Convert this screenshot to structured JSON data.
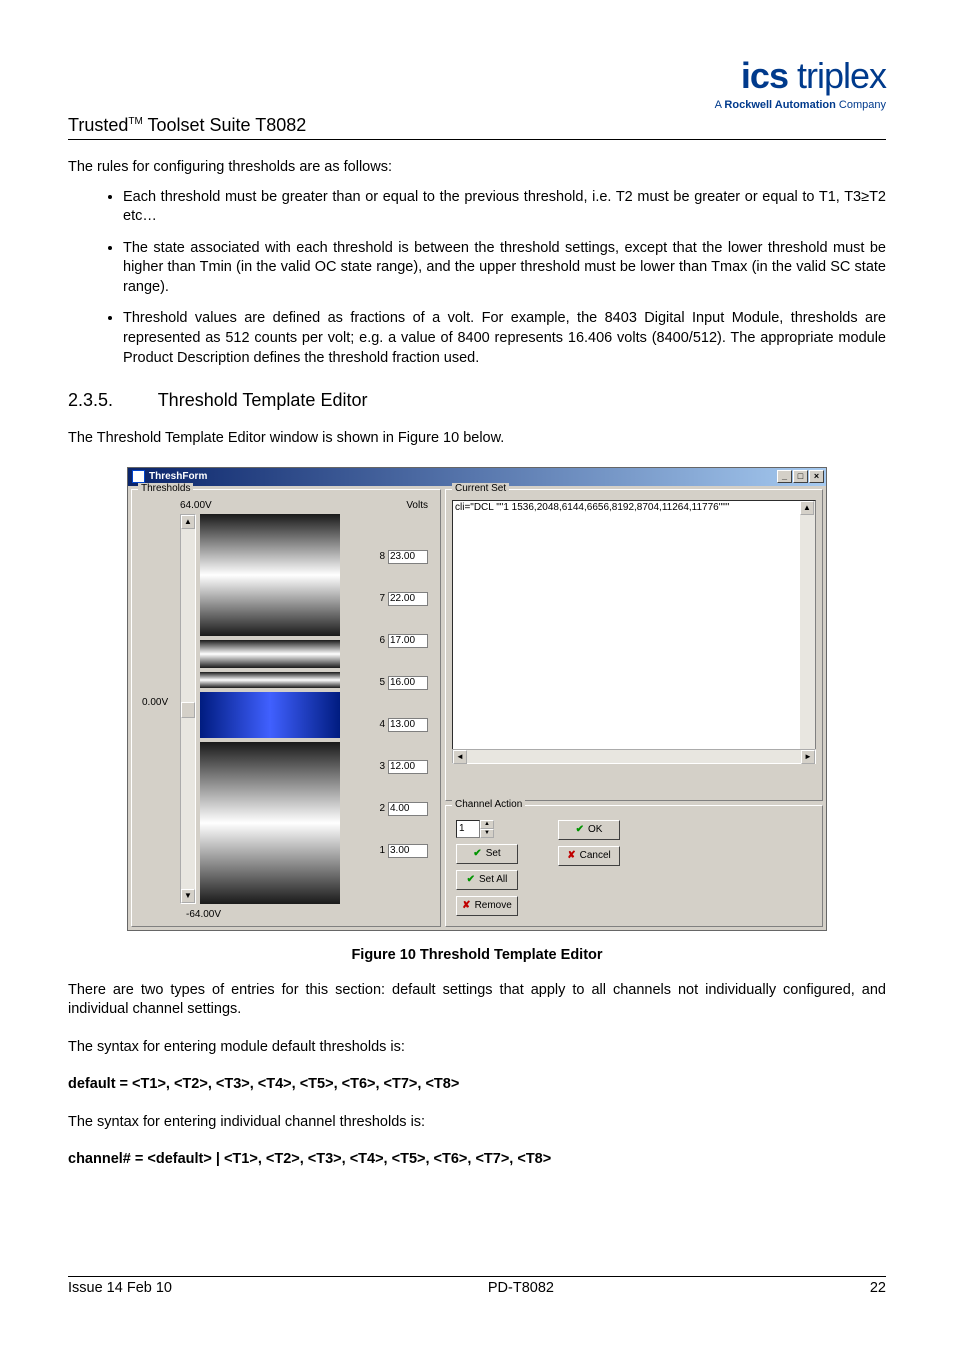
{
  "header": {
    "title_prefix": "Trusted",
    "title_tm": "TM",
    "title_suffix": " Toolset Suite T8082"
  },
  "logo": {
    "bold": "ics",
    "light": " triplex",
    "sub_a": "A ",
    "sub_b": "Rockwell Automation",
    "sub_c": " Company"
  },
  "intro": "The rules for configuring thresholds are as follows:",
  "bullets": [
    "Each threshold must be greater than or equal to the previous threshold, i.e. T2 must be greater or equal to T1, T3≥T2 etc…",
    "The state associated with each threshold is between the threshold settings, except that the lower threshold must be higher than Tmin (in the valid OC state range), and the upper threshold must be lower than Tmax (in the valid SC state range).",
    "Threshold values are defined as fractions of a volt. For example, the 8403 Digital Input Module, thresholds are represented as 512 counts per volt; e.g. a value of 8400 represents 16.406 volts (8400/512). The appropriate module Product Description defines the threshold fraction used."
  ],
  "section": {
    "num": "2.3.5.",
    "title": "Threshold Template Editor"
  },
  "section_body": "The Threshold Template Editor window is shown in Figure 10 below.",
  "window": {
    "title": "ThreshForm",
    "group_thresholds": "Thresholds",
    "group_currentset": "Current Set",
    "group_channel": "Channel Action",
    "max_v": "64.00V",
    "min_v": "-64.00V",
    "zero_v": "0.00V",
    "volts": "Volts",
    "current_set_text": "cli=\"DCL \"\"1 1536,2048,6144,6656,8192,8704,11264,11776\"\"\"",
    "channel_value": "1",
    "btn_set": "Set",
    "btn_setall": "Set All",
    "btn_remove": "Remove",
    "btn_ok": "OK",
    "btn_cancel": "Cancel",
    "rows": [
      {
        "n": "8",
        "v": "23.00"
      },
      {
        "n": "7",
        "v": "22.00"
      },
      {
        "n": "6",
        "v": "17.00"
      },
      {
        "n": "5",
        "v": "16.00"
      },
      {
        "n": "4",
        "v": "13.00"
      },
      {
        "n": "3",
        "v": "12.00"
      },
      {
        "n": "2",
        "v": "4.00"
      },
      {
        "n": "1",
        "v": "3.00"
      }
    ]
  },
  "figcaption": "Figure 10 Threshold Template Editor",
  "p_after1": "There are two types of entries for this section: default settings that apply to all channels not individually configured, and individual channel settings.",
  "p_after2": "The syntax for entering module default thresholds is:",
  "p_after3": "default = <T1>, <T2>, <T3>, <T4>, <T5>, <T6>, <T7>, <T8>",
  "p_after4": "The syntax for entering individual channel thresholds is:",
  "p_after5": "channel# = <default> | <T1>, <T2>, <T3>, <T4>, <T5>, <T6>, <T7>, <T8>",
  "footer": {
    "left": "Issue 14 Feb 10",
    "center": "PD-T8082",
    "right": "22"
  }
}
